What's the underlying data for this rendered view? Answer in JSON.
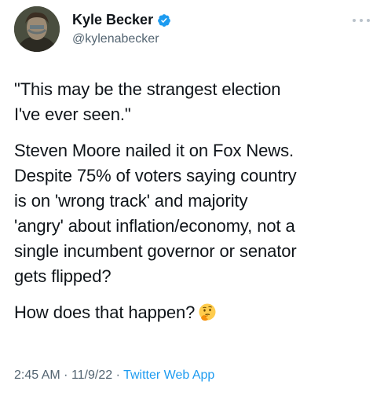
{
  "author": {
    "display_name": "Kyle Becker",
    "handle": "@kylenabecker",
    "avatar_icon": "avatar-photo",
    "verified_icon": "verified-badge-icon"
  },
  "tweet": {
    "paragraphs": [
      "\"This may be the strangest election\nI've ever seen.\"",
      "Steven Moore nailed it on Fox News.\nDespite 75% of voters saying country\nis on 'wrong track' and majority\n'angry' about inflation/economy, not a\nsingle incumbent governor or senator\ngets flipped?",
      "How does that happen?"
    ],
    "emoji_icon": "thinking-face-icon"
  },
  "meta": {
    "time": "2:45 AM",
    "separator": "·",
    "date": "11/9/22",
    "source": "Twitter Web App"
  },
  "colors": {
    "text": "#0f1419",
    "secondary": "#536471",
    "accent": "#1d9bf0"
  }
}
